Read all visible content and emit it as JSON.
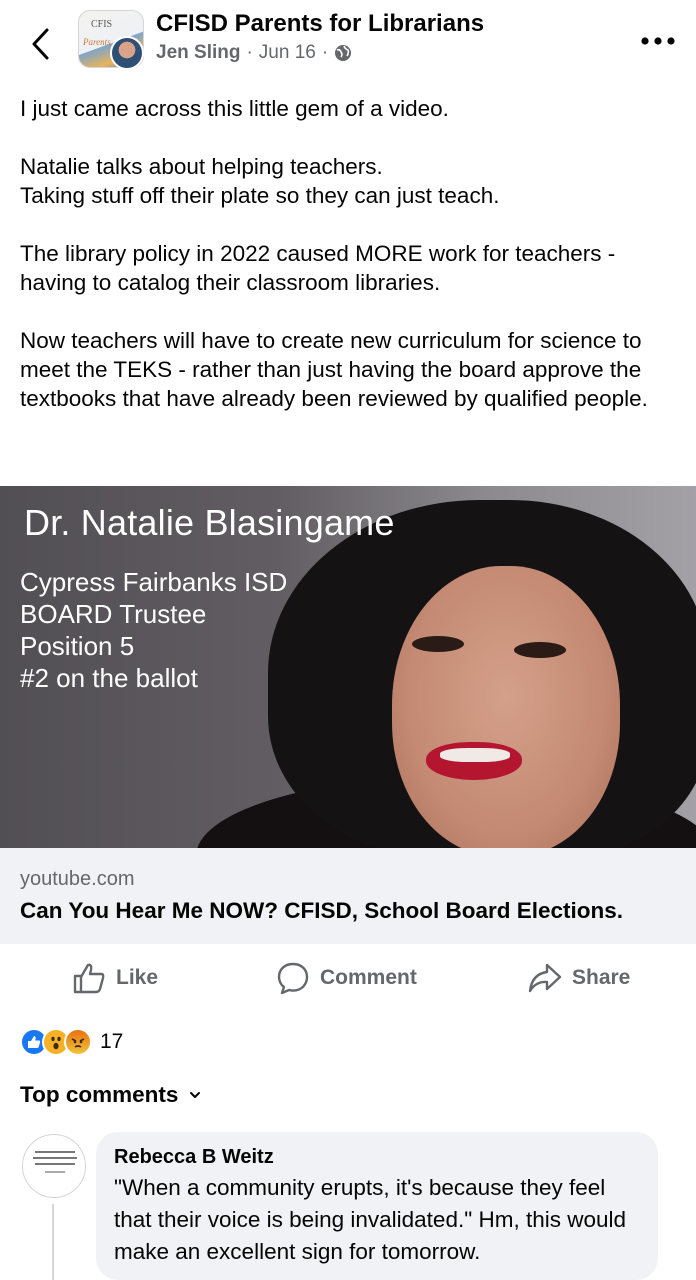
{
  "header": {
    "back_icon": "chevron-left-icon",
    "group_name": "CFISD Parents for Librarians",
    "author": "Jen Sling",
    "separator": "·",
    "date": "Jun 16",
    "privacy_icon": "globe-icon",
    "more_icon": "ellipsis-icon"
  },
  "post": {
    "paragraphs": [
      "I just came across this little gem of a video.",
      "Natalie talks about helping teachers.\nTaking stuff off their plate so they can just teach.",
      "The library policy in 2022 caused MORE work for teachers - having to catalog their classroom libraries.",
      "Now teachers will have to create new curriculum for science to meet the TEKS - rather than just having the board approve the textbooks that have already been reviewed by qualified people."
    ]
  },
  "link_card": {
    "thumbnail_title": "Dr. Natalie Blasingame",
    "thumbnail_lines": [
      "Cypress Fairbanks ISD",
      "BOARD Trustee",
      "Position 5",
      "#2 on the ballot"
    ],
    "info_icon": "info-icon",
    "info_label": "i",
    "domain": "youtube.com",
    "title": "Can You Hear Me NOW? CFISD, School Board Elections."
  },
  "actions": {
    "like": "Like",
    "comment": "Comment",
    "share": "Share"
  },
  "reactions": {
    "icons": [
      "like-reaction-icon",
      "wow-reaction-icon",
      "angry-reaction-icon"
    ],
    "count": "17"
  },
  "comments": {
    "section_label": "Top comments",
    "items": [
      {
        "author": "Rebecca B Weitz",
        "text": "\"When a community erupts, it's because they feel that their voice is being invalidated.\" Hm, this would make an excellent sign for tomorrow."
      }
    ]
  },
  "colors": {
    "text_primary": "#050505",
    "text_secondary": "#65676b",
    "card_bg": "#f0f2f5",
    "like_blue": "#1877f2"
  }
}
